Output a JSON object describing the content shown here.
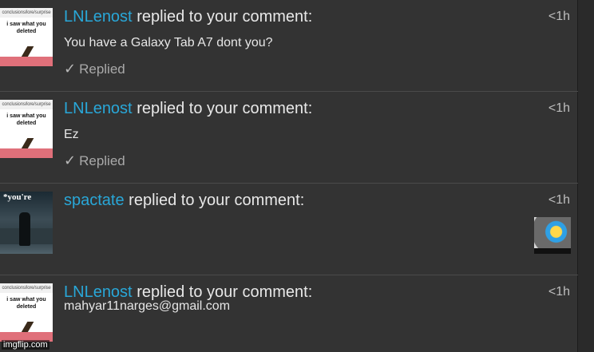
{
  "notifications": [
    {
      "username": "LNLenost",
      "action": "replied to your comment:",
      "time": "<1h",
      "text": "You have a Galaxy Tab A7 dont you?",
      "status": "Replied",
      "avatar": {
        "top_text": "conclusions/lore/surprise",
        "caption": "i saw what you deleted"
      }
    },
    {
      "username": "LNLenost",
      "action": "replied to your comment:",
      "time": "<1h",
      "text": "Ez",
      "status": "Replied",
      "avatar": {
        "top_text": "conclusions/lore/surprise",
        "caption": "i saw what you deleted"
      }
    },
    {
      "username": "spactate",
      "action": "replied to your comment:",
      "time": "<1h",
      "text": "",
      "status": "",
      "avatar": {
        "caption": "*you're"
      }
    },
    {
      "username": "LNLenost",
      "action": "replied to your comment:",
      "time": "<1h",
      "text": "mahyar11narges@gmail.com",
      "status": "",
      "avatar": {
        "top_text": "conclusions/lore/surprise",
        "caption": "i saw what you deleted"
      }
    }
  ],
  "check_icon": "✓",
  "watermark": "imgflip.com",
  "colors": {
    "username": "#29a7d8",
    "background": "#333333",
    "divider": "#4a4a4a"
  }
}
